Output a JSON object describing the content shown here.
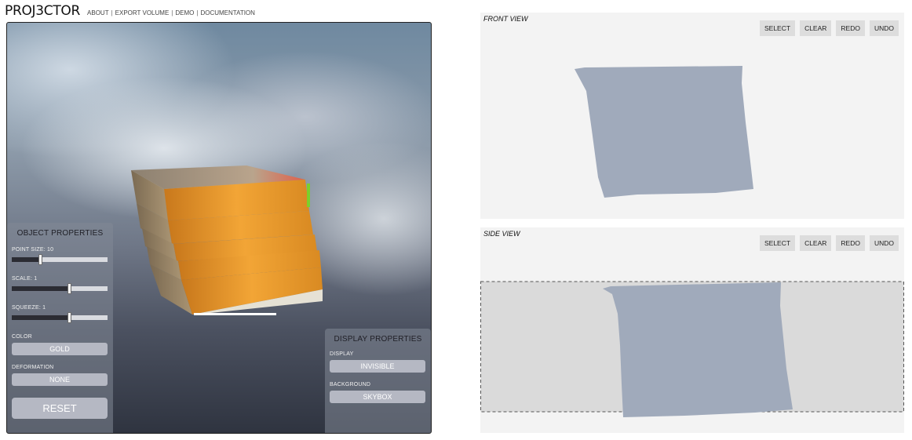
{
  "header": {
    "logo": "PROJ3CTOR",
    "nav": [
      {
        "label": "ABOUT"
      },
      {
        "label": "EXPORT VOLUME"
      },
      {
        "label": "DEMO"
      },
      {
        "label": "DOCUMENTATION"
      }
    ],
    "separator": "|"
  },
  "object_properties": {
    "title": "OBJECT PROPERTIES",
    "point_size_label": "POINT SIZE: 10",
    "point_size_level": 0.3,
    "scale_label": "SCALE: 1",
    "scale_level": 0.6,
    "squeeze_label": "SQUEEZE: 1",
    "squeeze_level": 0.6,
    "color_label": "COLOR",
    "color_value": "GOLD",
    "deformation_label": "DEFORMATION",
    "deformation_value": "NONE",
    "reset_label": "RESET"
  },
  "display_properties": {
    "title": "DISPLAY PROPERTIES",
    "display_label": "DISPLAY",
    "display_value": "INVISIBLE",
    "background_label": "BACKGROUND",
    "background_value": "SKYBOX"
  },
  "front_view": {
    "title": "FRONT VIEW",
    "tools": [
      "SELECT",
      "CLEAR",
      "REDO",
      "UNDO"
    ]
  },
  "side_view": {
    "title": "SIDE VIEW",
    "tools": [
      "SELECT",
      "CLEAR",
      "REDO",
      "UNDO"
    ]
  },
  "colors": {
    "shape_fill": "#a0aabb",
    "object_gold": "#e8962a",
    "panel_button": "#b5b8c3"
  }
}
